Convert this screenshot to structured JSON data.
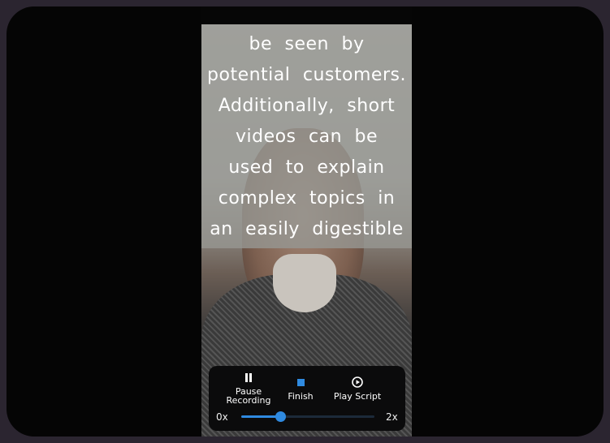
{
  "script_lines": [
    "be seen by",
    "potential customers.",
    "Additionally, short",
    "videos can be",
    "used to explain",
    "complex topics in",
    "an easily digestible"
  ],
  "controls": {
    "pause": {
      "label_line1": "Pause",
      "label_line2": "Recording",
      "icon": "pause-icon"
    },
    "finish": {
      "label": "Finish",
      "icon": "stop-icon"
    },
    "play_script": {
      "label": "Play Script",
      "icon": "play-circle-icon"
    },
    "speed": {
      "min_label": "0x",
      "max_label": "2x",
      "fraction": 0.29
    }
  },
  "colors": {
    "accent": "#2f8ae0"
  }
}
